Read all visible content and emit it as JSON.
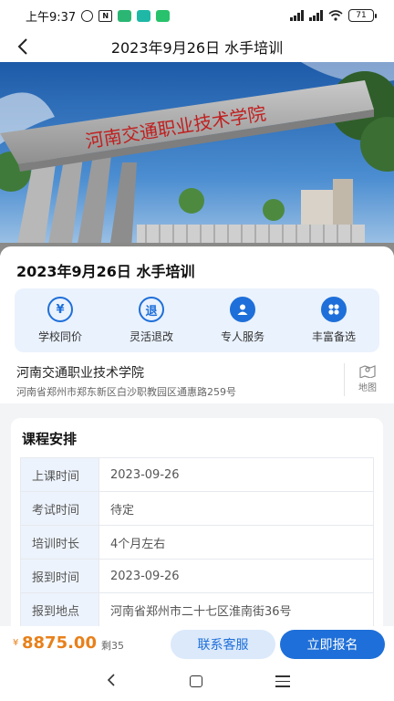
{
  "status_bar": {
    "time": "上午9:37",
    "battery": "71"
  },
  "nav": {
    "title": "2023年9月26日 水手培训"
  },
  "hero": {
    "gate_sign": "河南交通职业技术学院"
  },
  "course": {
    "title": "2023年9月26日 水手培训"
  },
  "features": [
    {
      "icon": "yuan-icon",
      "glyph": "¥",
      "label": "学校同价"
    },
    {
      "icon": "refund-icon",
      "glyph": "退",
      "label": "灵活退改"
    },
    {
      "icon": "person-icon",
      "glyph": "",
      "label": "专人服务"
    },
    {
      "icon": "grid-icon",
      "glyph": "",
      "label": "丰富备选"
    }
  ],
  "school": {
    "name": "河南交通职业技术学院",
    "address": "河南省郑州市郑东新区白沙职教园区通惠路259号",
    "map_label": "地图"
  },
  "schedule": {
    "title": "课程安排",
    "rows": [
      {
        "label": "上课时间",
        "value": "2023-09-26"
      },
      {
        "label": "考试时间",
        "value": "待定"
      },
      {
        "label": "培训时长",
        "value": "4个月左右"
      },
      {
        "label": "报到时间",
        "value": "2023-09-26"
      },
      {
        "label": "报到地点",
        "value": "河南省郑州市二十七区淮南街36号"
      }
    ]
  },
  "footer": {
    "currency": "¥",
    "price": "8875.00",
    "remain": "剩35",
    "contact_label": "联系客服",
    "signup_label": "立即报名"
  },
  "colors": {
    "accent": "#1e6fd9",
    "price": "#e8801a",
    "feature_bg": "#eaf2fd"
  }
}
